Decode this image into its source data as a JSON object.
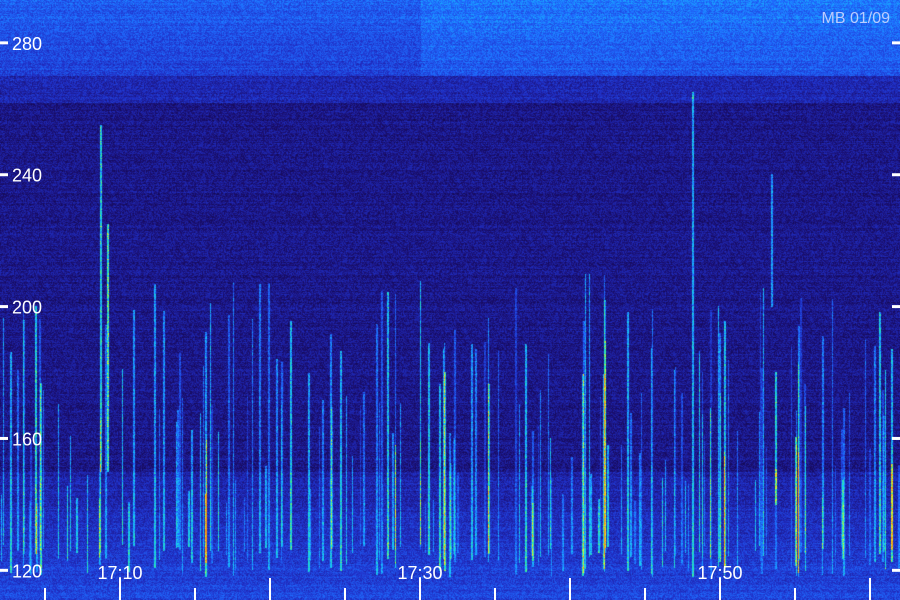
{
  "chart_data": {
    "type": "heatmap",
    "title": "MB 01/09",
    "xlabel": "",
    "ylabel": "",
    "y_ticks": [
      120,
      160,
      200,
      240,
      280
    ],
    "ylim": [
      111,
      293
    ],
    "x_ticks": [
      "17:10",
      "17:30",
      "17:50"
    ],
    "x_tick_minutes": [
      10,
      30,
      50
    ],
    "xlim_minutes": [
      2,
      62
    ],
    "x_minor_step_minutes": 5,
    "grid": false,
    "legend": "none",
    "colormap": [
      "#06021e",
      "#1a0e6e",
      "#2030c8",
      "#1f6dff",
      "#16c9ff",
      "#2df0a0",
      "#f0ff20",
      "#ff8c10"
    ],
    "colors": {
      "label": "#ffffff",
      "tick": "#ffffff"
    }
  }
}
